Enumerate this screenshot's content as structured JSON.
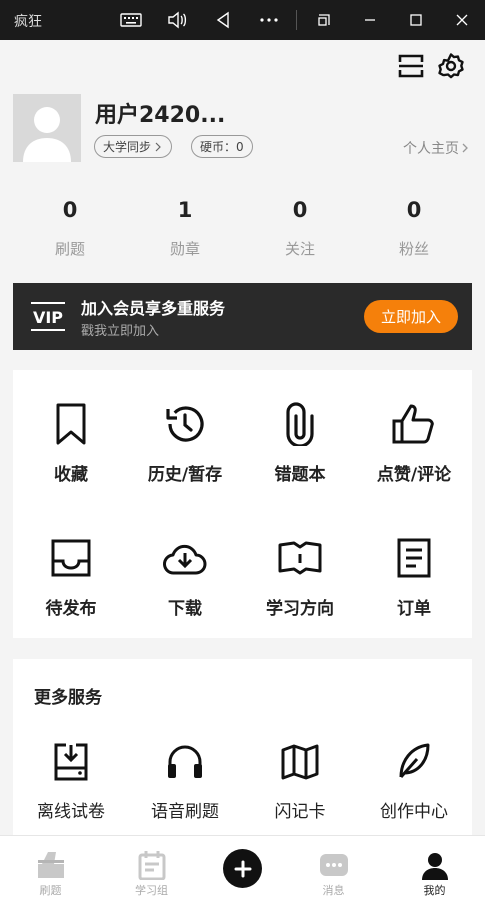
{
  "window": {
    "title": "疯狂",
    "buttons": [
      "keyboard-icon",
      "volume-icon",
      "back-icon",
      "more-icon",
      "restore-icon",
      "minimize-icon",
      "maximize-icon",
      "close-icon"
    ]
  },
  "top_actions": [
    "scan-icon",
    "settings-icon"
  ],
  "profile": {
    "username": "用户2420...",
    "school_label": "大学同步",
    "coin_label": "硬币：0",
    "homepage_label": "个人主页"
  },
  "stats": [
    {
      "value": "0",
      "label": "刷题"
    },
    {
      "value": "1",
      "label": "勋章"
    },
    {
      "value": "0",
      "label": "关注"
    },
    {
      "value": "0",
      "label": "粉丝"
    }
  ],
  "vip": {
    "logo": "VIP",
    "title": "加入会员享多重服务",
    "subtitle": "戳我立即加入",
    "button": "立即加入",
    "accent_color": "#f5800b"
  },
  "features": [
    {
      "icon": "bookmark-icon",
      "label": "收藏"
    },
    {
      "icon": "history-icon",
      "label": "历史/暂存"
    },
    {
      "icon": "paperclip-icon",
      "label": "错题本"
    },
    {
      "icon": "thumbs-up-icon",
      "label": "点赞/评论"
    },
    {
      "icon": "inbox-icon",
      "label": "待发布"
    },
    {
      "icon": "cloud-download-icon",
      "label": "下载"
    },
    {
      "icon": "book-open-icon",
      "label": "学习方向"
    },
    {
      "icon": "document-icon",
      "label": "订单"
    }
  ],
  "more_services": {
    "title": "更多服务",
    "items": [
      {
        "icon": "offline-download-icon",
        "label": "离线试卷"
      },
      {
        "icon": "headphones-icon",
        "label": "语音刷题"
      },
      {
        "icon": "map-icon",
        "label": "闪记卡"
      },
      {
        "icon": "feather-icon",
        "label": "创作中心"
      }
    ]
  },
  "bottom_nav": [
    {
      "icon": "practice-icon",
      "label": "刷题"
    },
    {
      "icon": "calendar-icon",
      "label": "学习组"
    },
    {
      "icon": "add-icon",
      "label": ""
    },
    {
      "icon": "message-icon",
      "label": "消息"
    },
    {
      "icon": "user-icon",
      "label": "我的",
      "active": true
    }
  ]
}
